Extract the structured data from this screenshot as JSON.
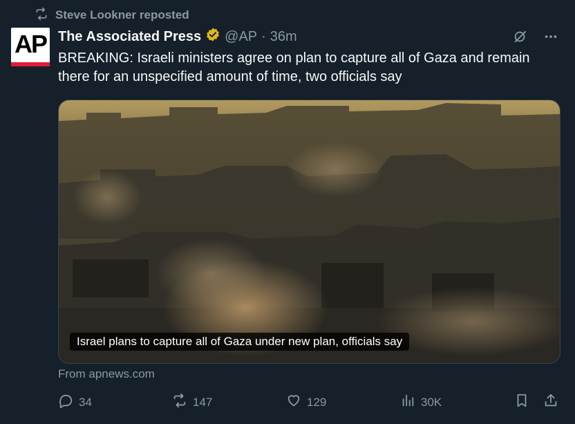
{
  "repost": {
    "text": "Steve Lookner reposted"
  },
  "author": {
    "name": "The Associated Press",
    "handle": "@AP",
    "separator": "·",
    "time": "36m",
    "avatar_text": "AP"
  },
  "tweet": {
    "text": "BREAKING: Israeli ministers agree on plan to capture all of Gaza and remain there for an unspecified amount of time, two officials say"
  },
  "card": {
    "caption": "Israel plans to capture all of Gaza under new plan, officials say",
    "source": "From apnews.com"
  },
  "actions": {
    "replies": "34",
    "reposts": "147",
    "likes": "129",
    "views": "30K"
  },
  "colors": {
    "background": "#15202b",
    "text_secondary": "#8b98a5",
    "verified_gold": "#e2b719",
    "ap_red": "#e31937"
  }
}
